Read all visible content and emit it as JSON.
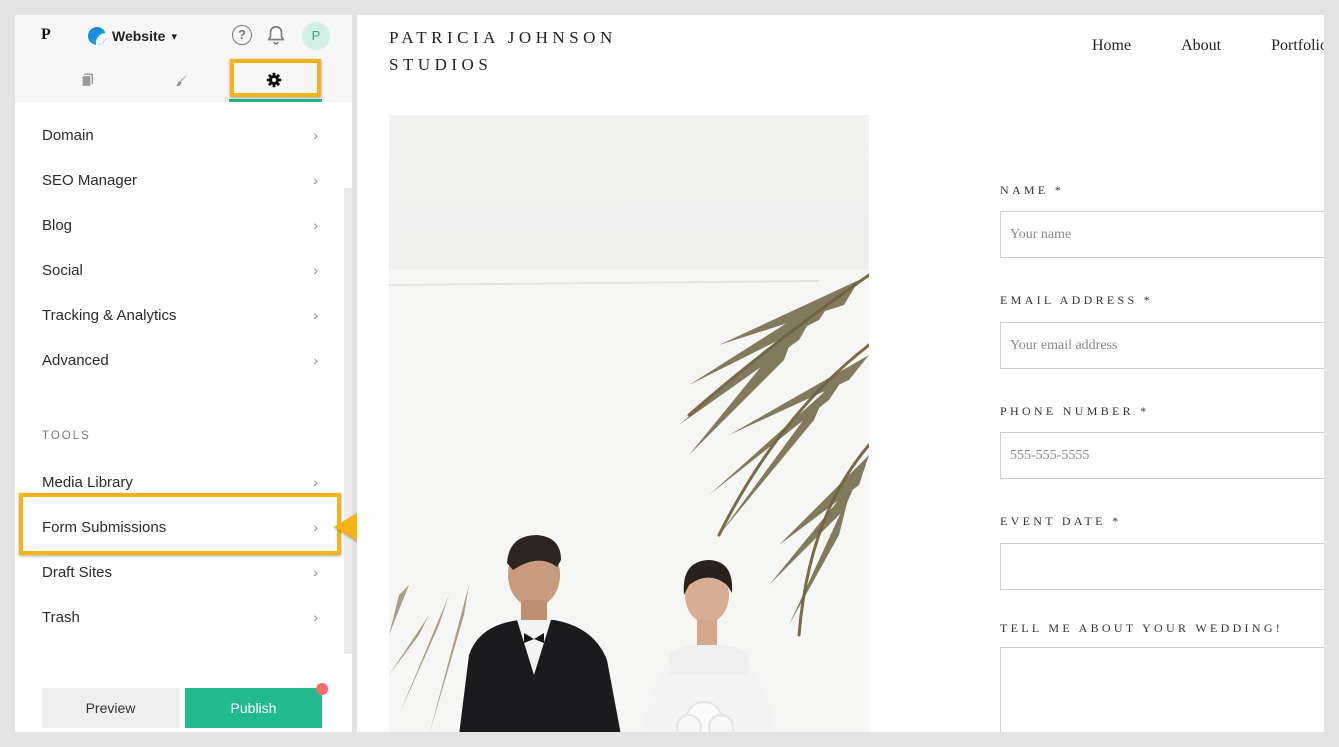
{
  "app": {
    "logo_letter": "P",
    "site_switcher_label": "Website",
    "help_glyph": "?",
    "avatar_initial": "P"
  },
  "tabs": [
    {
      "name": "pages",
      "icon": "pages-icon"
    },
    {
      "name": "design",
      "icon": "brush-icon"
    },
    {
      "name": "settings",
      "icon": "gear-icon",
      "active": true
    }
  ],
  "settings_menu": [
    {
      "label": "Domain"
    },
    {
      "label": "SEO Manager"
    },
    {
      "label": "Blog"
    },
    {
      "label": "Social"
    },
    {
      "label": "Tracking & Analytics"
    },
    {
      "label": "Advanced"
    }
  ],
  "tools": {
    "heading": "TOOLS",
    "items": [
      {
        "label": "Media Library"
      },
      {
        "label": "Form Submissions",
        "highlighted": true
      },
      {
        "label": "Draft Sites"
      },
      {
        "label": "Trash"
      }
    ]
  },
  "footer": {
    "preview_label": "Preview",
    "publish_label": "Publish"
  },
  "site": {
    "brand_line1": "PATRICIA JOHNSON",
    "brand_line2": "STUDIOS",
    "nav": [
      "Home",
      "About",
      "Portfolio"
    ],
    "form": {
      "name_label": "NAME *",
      "name_placeholder": "Your name",
      "email_label": "EMAIL ADDRESS *",
      "email_placeholder": "Your email address",
      "phone_label": "PHONE NUMBER *",
      "phone_placeholder": "555-555-5555",
      "date_label": "EVENT DATE *",
      "message_label": "TELL ME ABOUT YOUR WEDDING!"
    }
  },
  "colors": {
    "accent": "#22b98f",
    "highlight": "#f5b316",
    "notification": "#f26b6b"
  }
}
